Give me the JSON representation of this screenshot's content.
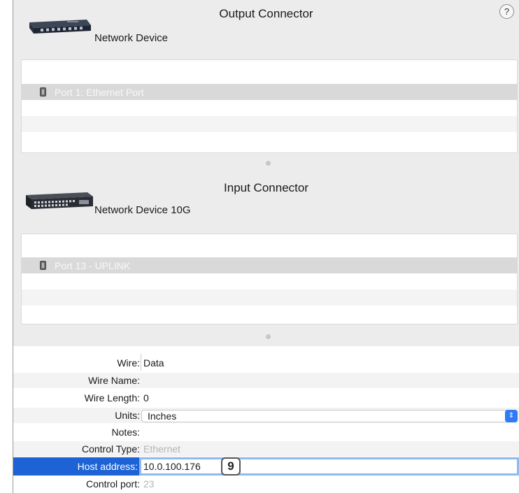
{
  "help": {
    "label": "?"
  },
  "output": {
    "title": "Output Connector",
    "device_name": "Network Device",
    "selected_port": "Port 1: Ethernet Port"
  },
  "input": {
    "title": "Input Connector",
    "device_name": "Network Device 10G",
    "selected_port": "Port 13 - UPLINK"
  },
  "properties": {
    "wire_label": "Wire:",
    "wire_value": "Data",
    "wire_name_label": "Wire Name:",
    "wire_name_value": "",
    "wire_length_label": "Wire Length:",
    "wire_length_value": "0",
    "units_label": "Units:",
    "units_value": "Inches",
    "notes_label": "Notes:",
    "notes_value": "",
    "control_type_label": "Control Type:",
    "control_type_value": "Ethernet",
    "host_address_label": "Host address:",
    "host_address_value": "10.0.100.176",
    "host_badge": "9",
    "control_port_label": "Control port:",
    "control_port_value": "23"
  },
  "colors": {
    "panel_bg": "#ececec",
    "selected_row": "#d9d9d9",
    "accent_blue": "#1d63d6",
    "focus_ring": "#8fb9ef"
  }
}
